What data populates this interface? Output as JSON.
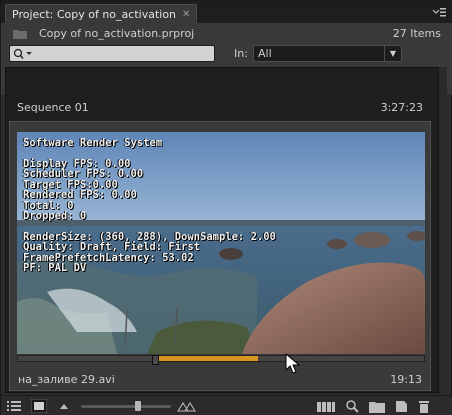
{
  "tab": {
    "label": "Project: Copy of no_activation",
    "close_glyph": "✕"
  },
  "panel_menu_glyph": "≡",
  "header": {
    "project_file": "Copy of no_activation.prproj",
    "item_count": "27 Items",
    "search": {
      "value": "",
      "placeholder": ""
    },
    "in_label": "In:",
    "in_selected": "All"
  },
  "sequence": {
    "name": "Sequence 01",
    "duration": "3:27:23"
  },
  "clip": {
    "name": "на_заливе 29.avi",
    "duration": "19:13",
    "playback_progress": 0.32,
    "overlay_lines": [
      "Software Render System",
      "",
      "Display FPS: 0.00",
      "Scheduler FPS: 0.00",
      "Target FPS:0.00",
      "Rendered FPS: 0.00",
      "Total: 0",
      "Dropped: 0",
      "",
      "RenderSize: (360, 288), DownSample: 2.00",
      "Quality: Draft, Field: First",
      "FramePrefetchLatency: 53.02",
      "PF: PAL DV"
    ]
  },
  "toolbar": {
    "list_view": "list-view-icon",
    "icon_view": "icon-view-icon",
    "automate": "automate-to-sequence-icon",
    "find": "find-icon",
    "new_bin": "new-bin-icon",
    "new_item": "new-item-icon",
    "delete": "delete-icon"
  },
  "colors": {
    "accent_scrub": "#d8951f",
    "panel_bg": "#393939",
    "list_bg": "#1f1f1f"
  }
}
